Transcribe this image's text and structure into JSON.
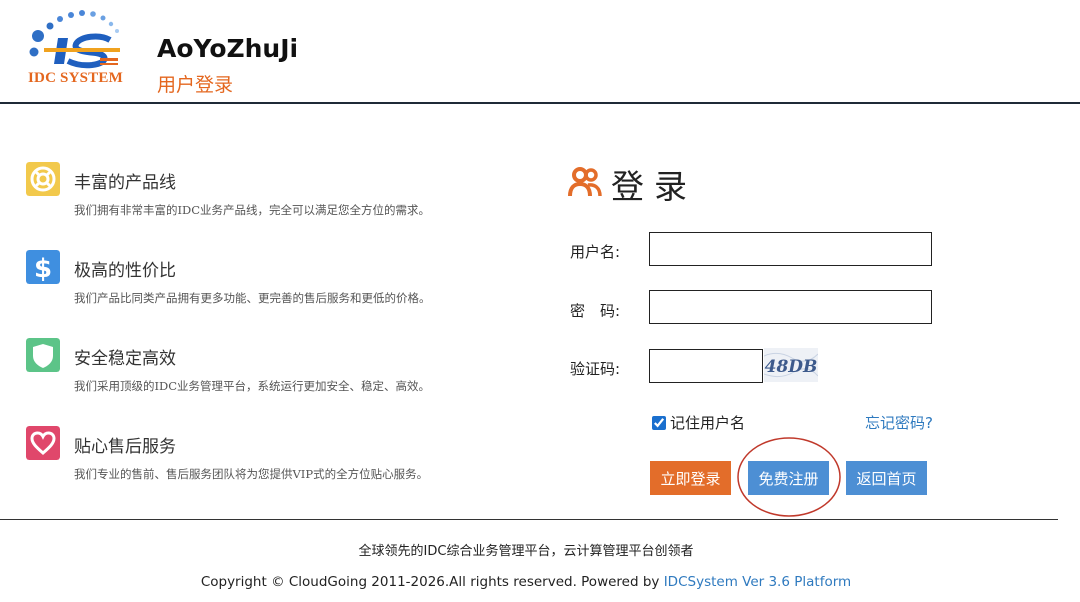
{
  "header": {
    "logo_text": "IDC SYSTEM",
    "site_name": "AoYoZhuJi",
    "page_title": "用户登录"
  },
  "features": [
    {
      "icon": "lifebuoy-icon",
      "color": "#f2c94c",
      "title": "丰富的产品线",
      "desc": "我们拥有非常丰富的IDC业务产品线，完全可以满足您全方位的需求。"
    },
    {
      "icon": "dollar-icon",
      "color": "#3f8fe0",
      "title": "极高的性价比",
      "desc": "我们产品比同类产品拥有更多功能、更完善的售后服务和更低的价格。"
    },
    {
      "icon": "shield-icon",
      "color": "#5cc488",
      "title": "安全稳定高效",
      "desc": "我们采用顶级的IDC业务管理平台，系统运行更加安全、稳定、高效。"
    },
    {
      "icon": "heart-icon",
      "color": "#e0476b",
      "title": "贴心售后服务",
      "desc": "我们专业的售前、售后服务团队将为您提供VIP式的全方位贴心服务。"
    }
  ],
  "login": {
    "title": "登录",
    "username_label": "用户名:",
    "username_value": "",
    "password_label": "密　码:",
    "password_value": "",
    "captcha_label": "验证码:",
    "captcha_value": "",
    "captcha_text": "48DB",
    "remember_label": "记住用户名",
    "remember_checked": true,
    "forgot_link": "忘记密码?",
    "login_button": "立即登录",
    "register_button": "免费注册",
    "home_button": "返回首页"
  },
  "footer": {
    "slogan": "全球领先的IDC综合业务管理平台，云计算管理平台创领者",
    "copyright": "Copyright © CloudGoing 2011-2026.All rights reserved. Powered by ",
    "platform_link": "IDCSystem Ver 3.6 Platform"
  },
  "colors": {
    "accent_orange": "#e36d2a",
    "accent_blue": "#4d8fd4",
    "link_blue": "#2f7abf",
    "annotation_red": "#c0392b"
  }
}
